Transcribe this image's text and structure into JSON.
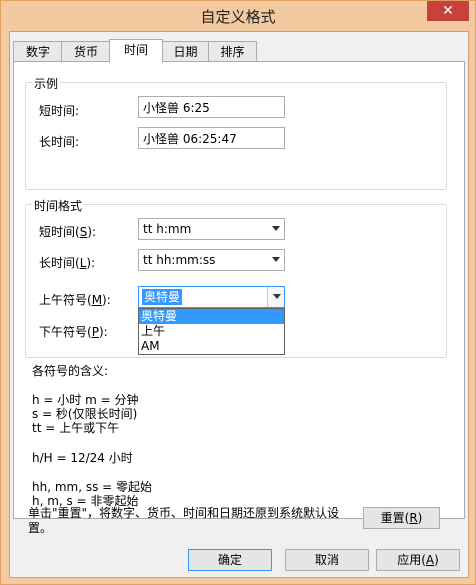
{
  "window": {
    "title": "自定义格式",
    "close_glyph": "✕"
  },
  "tabs": [
    {
      "label": "数字"
    },
    {
      "label": "货币"
    },
    {
      "label": "时间"
    },
    {
      "label": "日期"
    },
    {
      "label": "排序"
    }
  ],
  "example_group": {
    "title": "示例",
    "short_label": "短时间:",
    "short_value": "小怪兽 6:25",
    "long_label": "长时间:",
    "long_value": "小怪兽 06:25:47"
  },
  "format_group": {
    "title": "时间格式",
    "short_label": "短时间(",
    "short_key": "S",
    "short_value": "tt h:mm",
    "long_label": "长时间(",
    "long_key": "L",
    "long_value": "tt hh:mm:ss",
    "am_label": "上午符号(",
    "am_key": "M",
    "am_value": "奥特曼",
    "am_options": [
      "奥特曼",
      "上午",
      "AM"
    ],
    "pm_label": "下午符号(",
    "pm_key": "P",
    "label_suffix": "):"
  },
  "legend": {
    "heading": "各符号的含义:",
    "line1": "h = 小时    m = 分钟",
    "line2": "s = 秒(仅限长时间)",
    "line3": "tt = 上午或下午",
    "line4": "h/H = 12/24 小时",
    "line5": "hh, mm, ss = 零起始",
    "line6": "h, m, s = 非零起始"
  },
  "reset_note": {
    "line1": "单击\"重置\"，将数字、货币、时间和日期还原到系统默认设",
    "line2": "置。"
  },
  "buttons": {
    "reset_label": "重置(",
    "reset_key": "R",
    "ok_label": "确定",
    "cancel_label": "取消",
    "apply_label": "应用(",
    "apply_key": "A",
    "paren_close": ")"
  }
}
